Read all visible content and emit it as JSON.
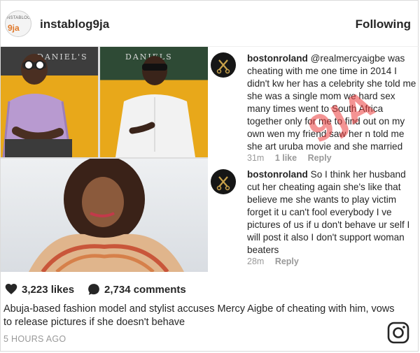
{
  "header": {
    "avatar_text_top": "INSTABLOG",
    "avatar_text_main": "9ja",
    "username": "instablog9ja",
    "follow_label": "Following"
  },
  "photo": {
    "sign_left": "DANIEL'S",
    "sign_right": "DANIELS",
    "watermark": "9JA"
  },
  "comments": [
    {
      "user": "bostonroland",
      "text": "@realmercyaigbe was cheating with me one time in 2014 I didn't kw her has a celebrity she told me she was a single mom we hard sex many times went to South Africa together only for me to find out on my own  wen my friend saw her n told me she art uruba movie and she married",
      "time": "31m",
      "likes": "1 like",
      "reply": "Reply"
    },
    {
      "user": "bostonroland",
      "text": "So I think her husband cut her cheating again she's like that believe me she wants to play victim forget it u can't fool everybody I ve pictures of us if u don't behave ur self I will post it also I don't support woman beaters",
      "time": "28m",
      "likes": "",
      "reply": "Reply"
    }
  ],
  "stats": {
    "likes": "3,223 likes",
    "comments": "2,734 comments"
  },
  "caption": "Abuja-based fashion model and stylist accuses Mercy Aigbe of cheating with him, vows to release pictures if she doesn't behave",
  "time_ago": "5 HOURS AGO",
  "icons": {
    "like": "heart-icon",
    "comment": "comment-bubble-icon",
    "brand": "instagram-icon",
    "commenter": "barber-logo-icon"
  },
  "colors": {
    "text": "#262626",
    "muted": "#999999",
    "watermark": "#eb3c3c"
  }
}
